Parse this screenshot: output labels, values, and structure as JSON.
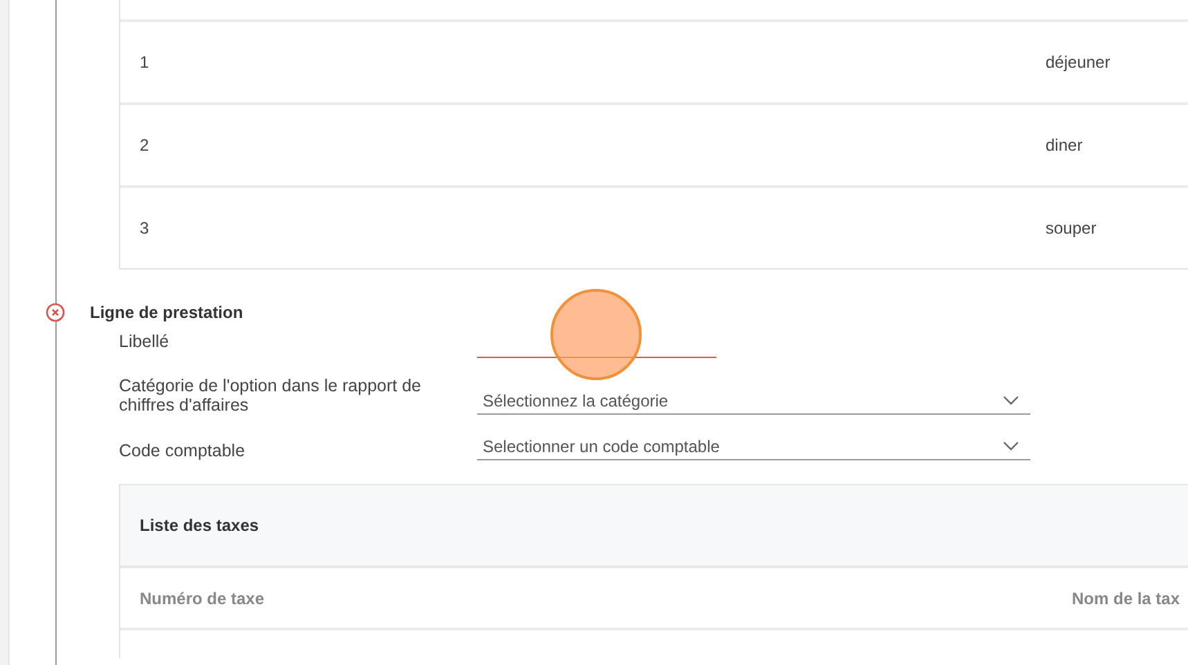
{
  "meals_table": {
    "rows": [
      {
        "cells": [
          "1",
          "déjeuner"
        ]
      },
      {
        "cells": [
          "2",
          "diner"
        ]
      },
      {
        "cells": [
          "3",
          "souper"
        ]
      }
    ]
  },
  "section": {
    "title": "Ligne de prestation",
    "has_error": true,
    "fields": [
      {
        "label": "Libellé",
        "kind": "text",
        "invalid": true
      },
      {
        "label": "Catégorie de l'option dans le rapport de chiffres d'affaires",
        "kind": "select",
        "placeholder": "Sélectionnez la catégorie",
        "invalid": false
      },
      {
        "label": "Code comptable",
        "kind": "select",
        "placeholder": "Selectionner un code comptable",
        "invalid": false
      }
    ],
    "tax_list": {
      "title": "Liste des taxes",
      "columns": [
        "Numéro de taxe",
        "Nom de la tax"
      ]
    }
  }
}
